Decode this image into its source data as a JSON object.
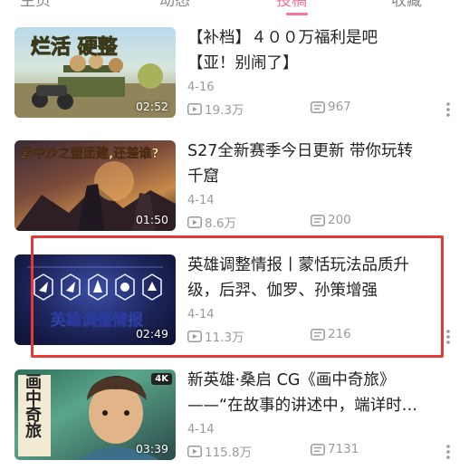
{
  "tabs": [
    {
      "label": "主页",
      "active": false
    },
    {
      "label": "动态",
      "active": false
    },
    {
      "label": "投稿",
      "active": true
    },
    {
      "label": "收藏",
      "active": false
    }
  ],
  "accent_color": "#fb7299",
  "highlight_color": "#e53935",
  "videos": [
    {
      "thumb_text": "烂活 硬整",
      "duration": "02:52",
      "title_lines": [
        "【补档】４００万福利是吧",
        "【亚！别闹了】"
      ],
      "date": "4-16",
      "views": "19.3万",
      "comments": "967"
    },
    {
      "thumb_text": "云中沙之盟团建,还差谁?",
      "duration": "01:50",
      "title_lines": [
        "S27全新赛季今日更新 带你玩转",
        "千窟"
      ],
      "date": "4-14",
      "views": "8.6万",
      "comments": "200"
    },
    {
      "thumb_text": "英雄调整情报",
      "duration": "02:49",
      "title_lines": [
        "英雄调整情报丨蒙恬玩法品质升",
        "级，后羿、伽罗、孙策增强"
      ],
      "date": "4-14",
      "views": "11.3万",
      "comments": "216",
      "highlighted": true
    },
    {
      "thumb_text": "画中奇旅",
      "badge": "4K",
      "duration": "03:39",
      "title_lines": [
        "新英雄·桑启 CG《画中奇旅》",
        "——“在故事的讲述中，端详时…"
      ],
      "date": "4-14",
      "views": "115.8万",
      "comments": "7131"
    }
  ],
  "icons": {
    "views": "play-count-icon",
    "comments": "danmaku-icon",
    "more": "more-dots-icon"
  }
}
